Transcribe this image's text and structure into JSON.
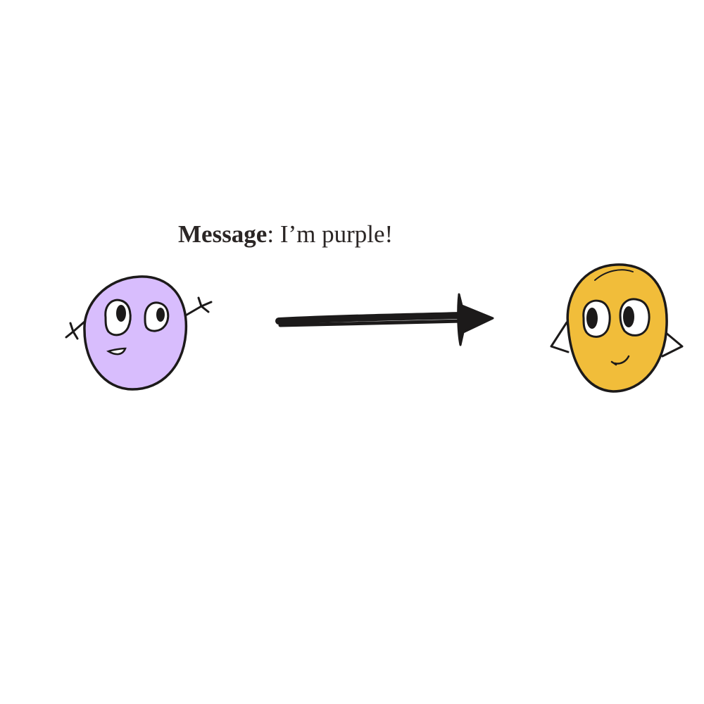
{
  "message": {
    "label": "Message",
    "separator": ": ",
    "text": "I’m purple!"
  },
  "colors": {
    "sender_body": "#d8bdfd",
    "receiver_body": "#f1bd3a",
    "ink": "#1c1a1a",
    "text": "#2b2625"
  },
  "icons": {
    "sender": "purple-character-icon",
    "receiver": "yellow-character-icon",
    "arrow": "right-arrow-icon"
  }
}
